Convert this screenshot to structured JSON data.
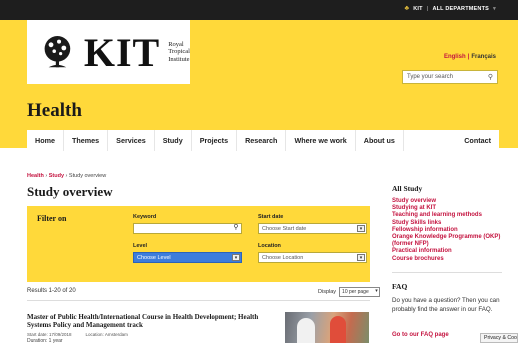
{
  "topbar": {
    "kit": "KIT",
    "all_departments": "ALL DEPARTMENTS"
  },
  "logo": {
    "name": "KIT",
    "line1": "Royal",
    "line2": "Tropical",
    "line3": "Institute"
  },
  "lang": {
    "english": "English",
    "francais": "Français"
  },
  "search": {
    "placeholder": "Type your search"
  },
  "page_title": "Health",
  "nav": [
    "Home",
    "Themes",
    "Services",
    "Study",
    "Projects",
    "Research",
    "Where we work",
    "About us"
  ],
  "nav_contact": "Contact",
  "breadcrumb": {
    "health": "Health",
    "study": "Study",
    "current": "Study overview",
    "sep": "›"
  },
  "heading": "Study overview",
  "filter": {
    "title": "Filter on",
    "keyword_label": "Keyword",
    "start_label": "Start date",
    "start_value": "Choose Start date",
    "level_label": "Level",
    "level_value": "Choose Level",
    "location_label": "Location",
    "location_value": "Choose Location"
  },
  "results": {
    "text": "Results 1-20 of 20",
    "display_label": "Display",
    "display_value": "10 per page"
  },
  "course": {
    "title": "Master of Public Health/International Course in Health Development; Health Systems Policy and Management track",
    "start": "Start date: 17/09/2018",
    "location": "Location: Amsterdam",
    "duration": "Duration: 1 year"
  },
  "sidebar": {
    "title": "All Study",
    "links": [
      "Study overview",
      "Studying at KIT",
      "Teaching and learning methods",
      "Study Skills links",
      "Fellowship information",
      "Orange Knowledge Programme (OKP) (former NFP)",
      "Practical information",
      "Course brochures"
    ]
  },
  "faq": {
    "title": "FAQ",
    "text": "Do you have a question? Then you can probably find the answer in our FAQ.",
    "link": "Go to our FAQ page"
  },
  "privacy": "Privacy & Cookies",
  "colors": {
    "accent": "#c4133f",
    "brand_yellow": "#ffd93a",
    "topbar": "#1e1e1e"
  }
}
